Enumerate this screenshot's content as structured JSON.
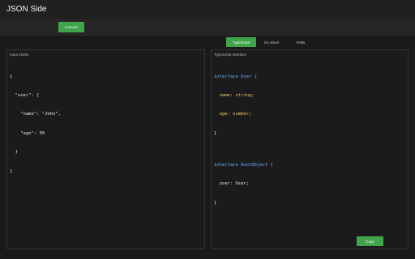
{
  "app": {
    "title": "JSON Side"
  },
  "toolbar": {
    "convert_label": "Convert"
  },
  "tabs": [
    {
      "label": "TypeScript",
      "active": true
    },
    {
      "label": "Go struct",
      "active": false
    },
    {
      "label": "YAML",
      "active": false
    }
  ],
  "input_panel": {
    "title": "Input JSON",
    "lines": [
      "{",
      "  \"user\": {",
      "    \"name\": \"John\",",
      "    \"age\": 30",
      "  }",
      "}"
    ]
  },
  "output_panel": {
    "title": "TypeScript Interface",
    "lines": [
      "interface User {",
      "  name: string;",
      "  age: number;",
      "}",
      "",
      "interface RootObject {",
      "  user: User;",
      "}"
    ],
    "copy_label": "Copy"
  },
  "colors": {
    "accent": "#3fa44a",
    "background": "#1a1a1a",
    "keyword": "#6fb1ff",
    "type": "#f0c674"
  }
}
